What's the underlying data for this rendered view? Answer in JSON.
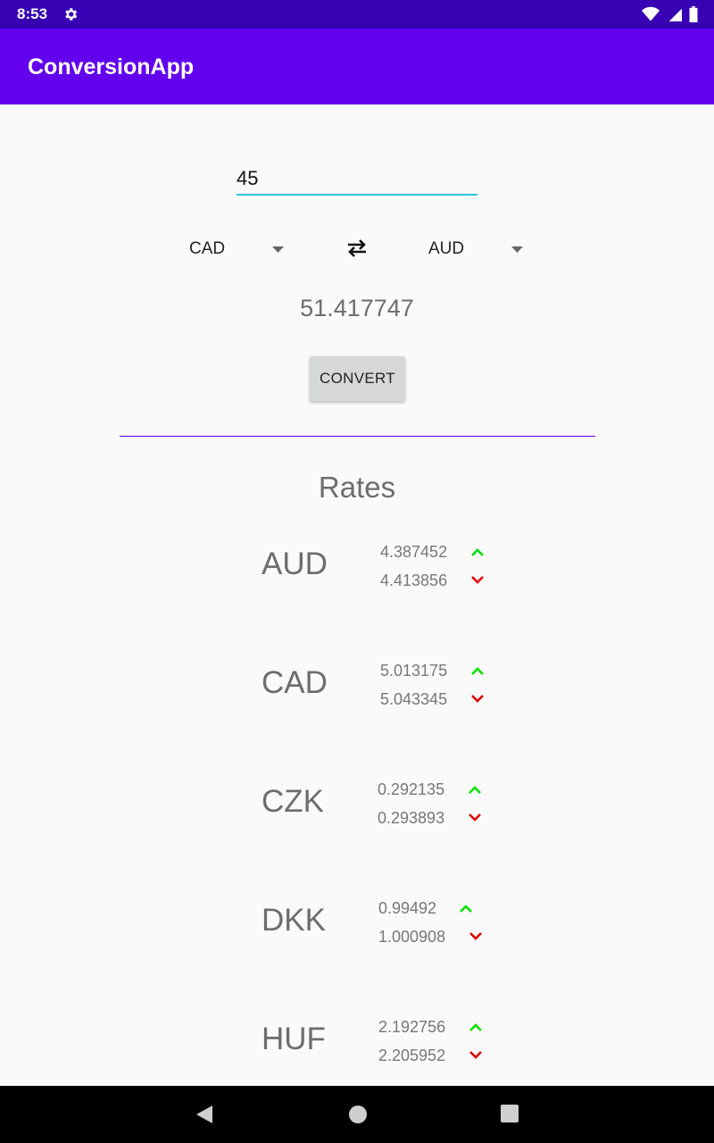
{
  "status_bar": {
    "time": "8:53"
  },
  "app_bar": {
    "title": "ConversionApp"
  },
  "converter": {
    "amount": "45",
    "from_currency": "CAD",
    "to_currency": "AUD",
    "result": "51.417747",
    "convert_label": "CONVERT"
  },
  "rates": {
    "title": "Rates",
    "items": [
      {
        "code": "AUD",
        "buy": "4.387452",
        "sell": "4.413856"
      },
      {
        "code": "CAD",
        "buy": "5.013175",
        "sell": "5.043345"
      },
      {
        "code": "CZK",
        "buy": "0.292135",
        "sell": "0.293893"
      },
      {
        "code": "DKK",
        "buy": "0.99492",
        "sell": "1.000908"
      },
      {
        "code": "HUF",
        "buy": "2.192756",
        "sell": "2.205952"
      }
    ]
  },
  "colors": {
    "status_bar": "#3700b3",
    "app_bar": "#6200ee",
    "accent": "#26c6da",
    "up": "#00e000",
    "down": "#e00000"
  },
  "icons": {
    "status": [
      "settings-icon",
      "wifi-icon",
      "signal-icon",
      "battery-icon"
    ],
    "swap": "swap-arrows-icon",
    "spinner": "dropdown-arrow-icon",
    "nav": [
      "back-icon",
      "home-icon",
      "recents-icon"
    ]
  }
}
